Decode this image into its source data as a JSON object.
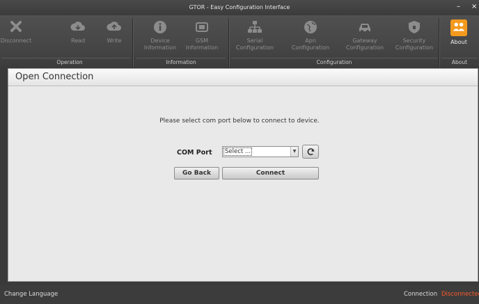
{
  "window": {
    "title": "GTOR - Easy Configuration Interface",
    "minimize": "–",
    "close": "×"
  },
  "ribbon": {
    "buttons": {
      "disconnect": "Disconnect",
      "read": "Read",
      "write": "Write",
      "device_info_1": "Device",
      "device_info_2": "Information",
      "gsm_info_1": "GSM",
      "gsm_info_2": "Information",
      "serial_1": "Serial",
      "serial_2": "Configuration",
      "apn_1": "Apn",
      "apn_2": "Configuration",
      "gateway_1": "Gateway",
      "gateway_2": "Configuration",
      "security_1": "Security",
      "security_2": "Configuration",
      "about": "About"
    },
    "groups": {
      "operation": "Operation",
      "information": "Information",
      "configuration": "Configuration",
      "about": "About"
    }
  },
  "panel": {
    "title": "Open Connection",
    "instruction": "Please select com port below to connect to device.",
    "com_port_label": "COM Port",
    "com_port_value": "Select ...",
    "go_back": "Go Back",
    "connect": "Connect"
  },
  "status": {
    "change_language": "Change Language",
    "connection_label": "Connection",
    "connection_value": "Disconnected"
  }
}
